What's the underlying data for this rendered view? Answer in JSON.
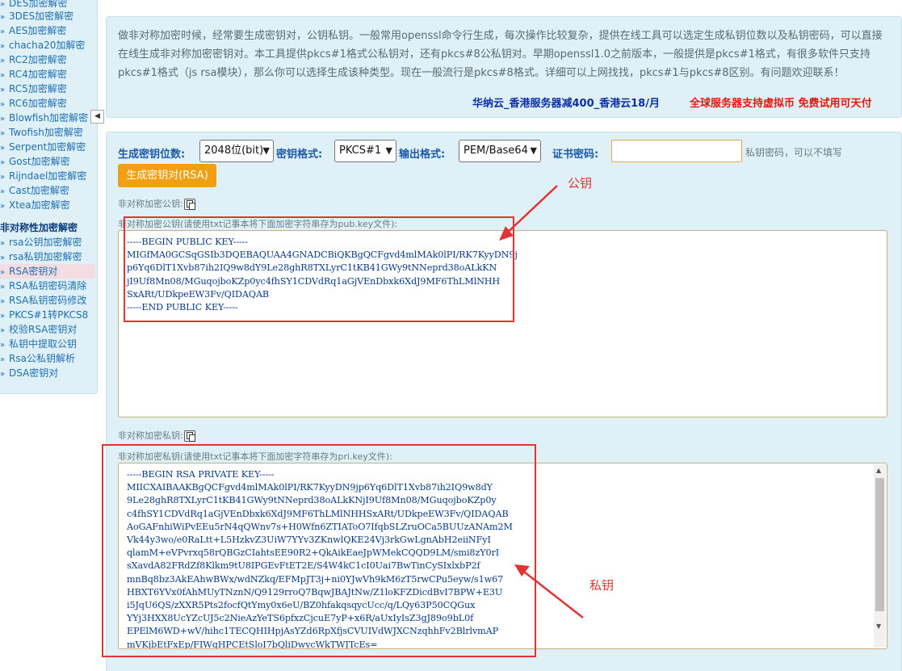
{
  "sidebar": {
    "items": [
      {
        "label": "DES加密解密",
        "active": false
      },
      {
        "label": "3DES加密解密",
        "active": false
      },
      {
        "label": "AES加密解密",
        "active": false
      },
      {
        "label": "chacha20加解密",
        "active": false
      },
      {
        "label": "RC2加密解密",
        "active": false
      },
      {
        "label": "RC4加密解密",
        "active": false
      },
      {
        "label": "RC5加密解密",
        "active": false
      },
      {
        "label": "RC6加密解密",
        "active": false
      },
      {
        "label": "Blowfish加密解密",
        "active": false
      },
      {
        "label": "Twofish加密解密",
        "active": false
      },
      {
        "label": "Serpent加密解密",
        "active": false
      },
      {
        "label": "Gost加密解密",
        "active": false
      },
      {
        "label": "Rijndael加密解密",
        "active": false
      },
      {
        "label": "Cast加密解密",
        "active": false
      },
      {
        "label": "Xtea加密解密",
        "active": false
      }
    ],
    "section_header": "非对称性加密解密",
    "section_items": [
      {
        "label": "rsa公钥加密解密",
        "active": false
      },
      {
        "label": "rsa私钥加密解密",
        "active": false
      },
      {
        "label": "RSA密钥对",
        "active": true
      },
      {
        "label": "RSA私钥密码清除",
        "active": false
      },
      {
        "label": "RSA私钥密码修改",
        "active": false
      },
      {
        "label": "PKCS#1转PKCS8",
        "active": false
      },
      {
        "label": "校验RSA密钥对",
        "active": false
      },
      {
        "label": "私钥中提取公钥",
        "active": false
      },
      {
        "label": "Rsa公私钥解析",
        "active": false
      },
      {
        "label": "DSA密钥对",
        "active": false
      }
    ],
    "collapse_glyph": "◀"
  },
  "intro": {
    "text": "做非对称加密时候，经常要生成密钥对，公钥私钥。一般常用openssl命令行生成，每次操作比较复杂，提供在线工具可以选定生成私钥位数以及私钥密码，可以直接在线生成非对称加密密钥对。本工具提供pkcs#1格式公私钥对，还有pkcs#8公私钥对。早期openssl1.0之前版本，一般提供是pkcs#1格式，有很多软件只支持pkcs#1格式（js rsa模块），那么你可以选择生成该种类型。现在一般流行是pkcs#8格式。详细可以上网找找，pkcs#1与pkcs#8区别。有问题欢迎联系！",
    "promo_1": "华纳云_香港服务器减400_香港云18/月",
    "promo_2": "全球服务器支持虚拟币 免费试用可天付"
  },
  "form": {
    "bits_label": "生成密钥位数:",
    "bits_value": "2048位(bit)",
    "format_label": "密钥格式:",
    "format_value": "PKCS#1",
    "output_label": "输出格式:",
    "output_value": "PEM/Base64",
    "password_label": "证书密码:",
    "password_value": "",
    "password_hint": "私钥密码，可以不填写",
    "generate_button": "生成密钥对(RSA)"
  },
  "public_key": {
    "copy_label": "非对称加密公钥:",
    "caption": "非对称加密公钥(请使用txt记事本将下面加密字符串存为pub.key文件):",
    "lines": [
      "-----BEGIN PUBLIC KEY-----",
      "MIGfMA0GCSqGSIb3DQEBAQUAA4GNADCBiQKBgQCFgvd4mlMAk0lPI/RK7KyyDN9j",
      "p6Yq6DlT1Xvb87ih2IQ9w8dY9Le28ghR8TXLyrC1tKB41GWy9tNNeprd38oALkKN",
      "jI9Uf8Mn08/MGuqojboKZp0yc4fhSY1CDVdRq1aGjVEnDbxk6XdJ9MF6ThLMlNHH",
      "SxARt/UDkpeEW3Fv/QIDAQAB",
      "-----END PUBLIC KEY-----"
    ]
  },
  "private_key": {
    "copy_label": "非对称加密私钥:",
    "caption": "非对称加密私钥(请使用txt记事本将下面加密字符串存为pri.key文件):",
    "lines": [
      "-----BEGIN RSA PRIVATE KEY-----",
      "MIICXAIBAAKBgQCFgvd4mlMAk0lPI/RK7KyyDN9jp6Yq6DlT1Xvb87ih2IQ9w8dY",
      "9Le28ghR8TXLyrC1tKB41GWy9tNNeprd38oALkKNjI9Uf8Mn08/MGuqojboKZp0y",
      "c4fhSY1CDVdRq1aGjVEnDbxk6XdJ9MF6ThLMlNHHSxARt/UDkpeEW3Fv/QIDAQAB",
      "AoGAFnhiWiPvEEu5rN4qQWnv7s+H0Wfn6ZTIAToO7IfqbSLZruOCa5BUUzANAm2M",
      "Vk44y3wo/e0RaLtt+L5HzkvZ3UiW7YYv3ZKnwlQKE24Vj3rkGwLgnAbH2eiiNFyI",
      "qlamM+eVPvrxq58rQBGzCIahtsEE90R2+QkAikEaeJpWMekCQQD9LM/smi8zY0rI",
      "sXavdA82FRdZf8Klkm9tU8IPGEvFtET2E/S4W4kC1cI0Uai7BwTinCySIxlxbP2f",
      "mnBq8bz3AkEAhwBWx/wdNZkq/EFMpJT3j+ni0YJwVh9kM6zT5rwCPu5eyw/s1w67",
      "HBXT6YVx0fAhMUyTNznN/Q9129rroQ7BqwJBAJtNw/Z1loKFZDicdBvI7BPW+E3U",
      "i5JqU6QS/zXXR5Pts2focfQtYmy0x6eU/BZ0hfakqsqycUcc/q/LQy63P50CQGux",
      "YYj3HXX8UcYZcUJ5c2NieAzYeTS6pfxzCjcuE7yP+x6R/aUxIyIsZ3gJ89o9bL0f",
      "EPElM6WD+wV/hihc1TECQHIHpjAsYZd6RpXfjsCVUIVdWJXCNzqhhFv2BlrlvmAP",
      "mVKjbEtFxEp/FIWqHPCEtSloI7bQliDwycWkTWJTcEs="
    ]
  },
  "annotations": {
    "public_label": "公钥",
    "private_label": "私钥",
    "color": "#e23434"
  },
  "colors": {
    "panel_bg": "#dff0f7",
    "label_blue": "#1c5aa8",
    "button_orange": "#f0a012",
    "key_text": "#0a3a86"
  }
}
